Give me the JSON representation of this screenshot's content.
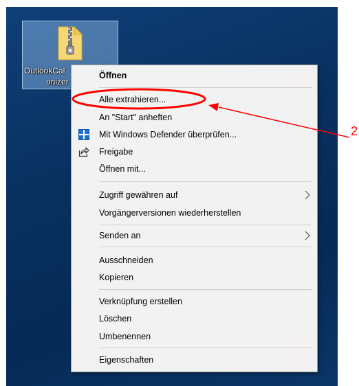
{
  "desktop_file": {
    "label_line1": "OutlookCal",
    "label_line2": "onizer",
    "icon": "zip-folder-icon"
  },
  "context_menu": {
    "items": [
      {
        "label": "Öffnen"
      },
      {
        "label": "Alle extrahieren..."
      },
      {
        "label": "An \"Start\" anheften"
      },
      {
        "label": "Mit Windows Defender überprüfen...",
        "icon": "windows-defender-icon"
      },
      {
        "label": "Freigabe",
        "icon": "share-icon"
      },
      {
        "label": "Öffnen mit..."
      },
      {
        "label": "Zugriff gewähren auf",
        "icon": "submenu-arrow-icon"
      },
      {
        "label": "Vorgängerversionen wiederherstellen"
      },
      {
        "label": "Senden an",
        "icon": "submenu-arrow-icon"
      },
      {
        "label": "Ausschneiden"
      },
      {
        "label": "Kopieren"
      },
      {
        "label": "Verknüpfung erstellen"
      },
      {
        "label": "Löschen"
      },
      {
        "label": "Umbenennen"
      },
      {
        "label": "Eigenschaften"
      }
    ]
  },
  "annotation": {
    "step_number": "2",
    "color": "#ff0000"
  }
}
